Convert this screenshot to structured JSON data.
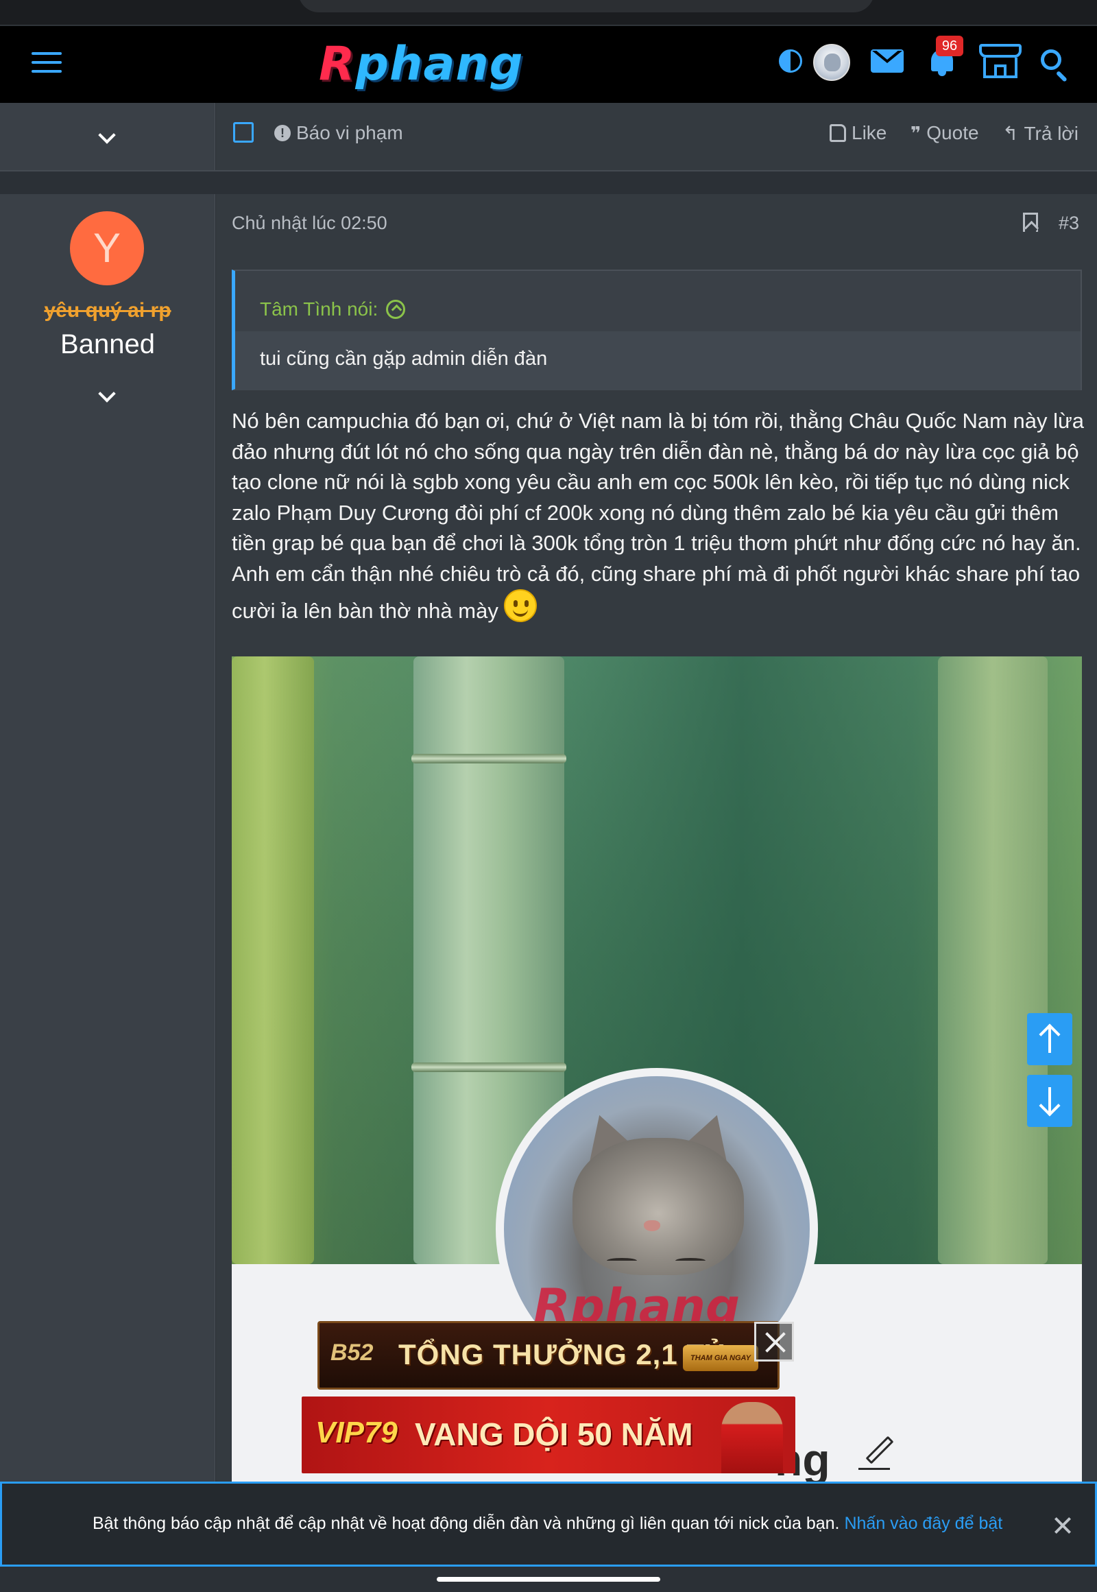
{
  "header": {
    "logo_part1": "R",
    "logo_part2": "phang",
    "notification_count": "96",
    "icons": [
      "menu-icon",
      "contrast-icon",
      "avatar",
      "mail-icon",
      "bell-icon",
      "store-icon",
      "search-icon"
    ],
    "accent_color": "#3aa8ff"
  },
  "prev_post_actions": {
    "report_label": "Báo vi phạm",
    "like_label": "Like",
    "quote_label": "Quote",
    "reply_label": "Trả lời"
  },
  "post": {
    "author_initial": "Y",
    "author_name": "yêu quý ai rp",
    "author_title": "Banned",
    "date": "Chủ nhật lúc 02:50",
    "number": "#3",
    "quote": {
      "author_line": "Tâm Tình nói:",
      "text": "tui cũng cần gặp admin diễn đàn"
    },
    "body": "Nó bên campuchia đó bạn ơi, chứ ở Việt nam là bị tóm rồi, thằng Châu Quốc Nam này lừa đảo nhưng đút lót nó cho sống qua ngày trên diễn đàn nè, thằng bá dơ này lừa cọc giả bộ tạo clone nữ nói là sgbb xong yêu cầu anh em cọc 500k lên kèo, rồi tiếp tục nó dùng nick zalo Phạm Duy Cương đòi phí cf 200k xong nó dùng thêm zalo bé kia yêu cầu gửi thêm tiền grap bé qua bạn để chơi là 300k tổng tròn 1 triệu thơm phứt như đống cức nó hay ăn. Anh em cẩn thận nhé chiêu trò cả đó, cũng share phí mà đi phốt người khác share phí tao cười ỉa lên bàn thờ nhà mày",
    "image": {
      "watermark": "Rphang",
      "name_fragment": "ng"
    }
  },
  "ads": {
    "ad1_brand": "B52",
    "ad1_text": "TỔNG THƯỞNG 2,1 TỶ",
    "ad1_button": "THAM GIA NGAY",
    "ad2_brand": "VIP79",
    "ad2_text": "VANG DỘI 50 NĂM"
  },
  "notice": {
    "text": "Bật thông báo cập nhật để cập nhật về hoạt động diễn đàn và những gì liên quan tới nick của bạn.",
    "link": "Nhấn vào đây để bật"
  }
}
